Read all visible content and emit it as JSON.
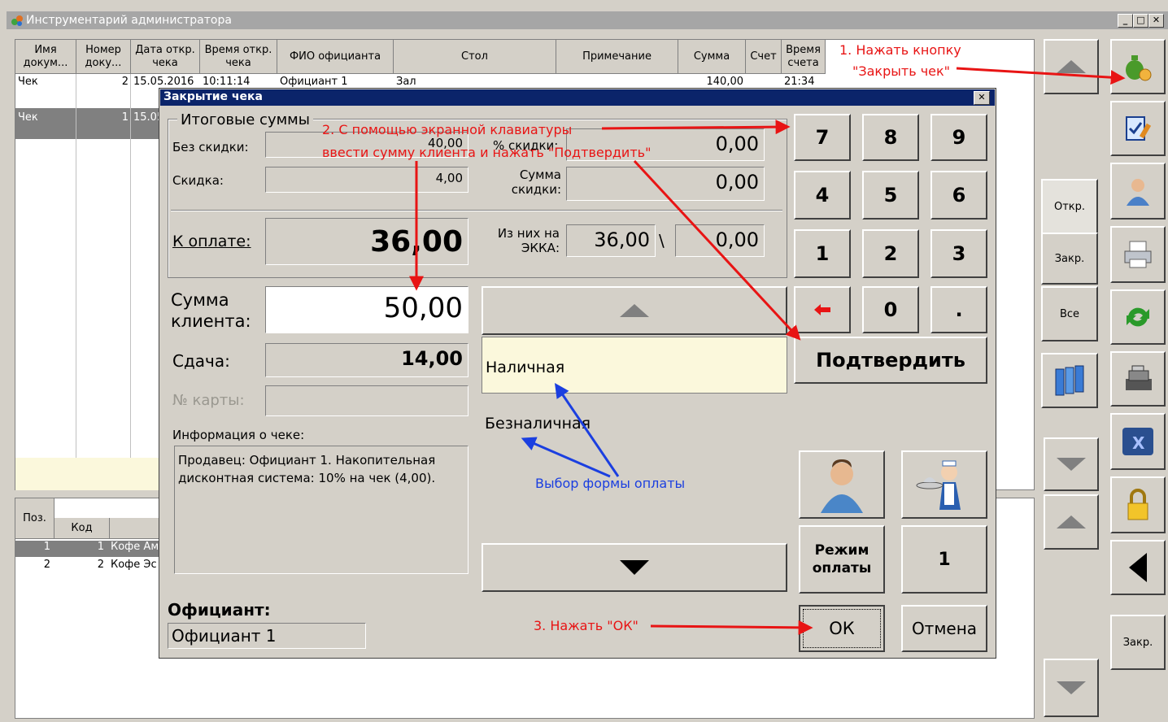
{
  "window": {
    "title": "Инструментарий администратора"
  },
  "table": {
    "headers": [
      "Имя докум...",
      "Номер доку...",
      "Дата откр. чека",
      "Время откр. чека",
      "ФИО официанта",
      "Стол",
      "Примечание",
      "Сумма",
      "Счет",
      "Время счета"
    ],
    "rows": [
      [
        "Чек",
        "2",
        "15.05.2016",
        "10:11:14",
        "Официант 1",
        "Зал",
        "",
        "140,00",
        "",
        "21:34"
      ],
      [
        "Чек",
        "1",
        "15.05",
        "",
        "",
        "",
        "",
        "",
        "",
        ""
      ]
    ]
  },
  "items_table": {
    "headers": [
      "Поз.",
      "Код"
    ],
    "rows": [
      [
        "1",
        "1",
        "Кофе Ам"
      ],
      [
        "2",
        "2",
        "Кофе Эс"
      ]
    ]
  },
  "right_panel": {
    "filter_open": "Откр.",
    "filter_closed": "Закр.",
    "filter_all": "Все",
    "close_label": "Закр."
  },
  "dialog": {
    "title": "Закрытие чека",
    "group_totals": "Итоговые суммы",
    "no_discount_label": "Без скидки:",
    "no_discount_value": "40,00",
    "discount_label": "Скидка:",
    "discount_value": "4,00",
    "discount_pct_label": "% скидки:",
    "discount_pct_value": "0,00",
    "discount_sum_label": "Сумма скидки:",
    "discount_sum_value": "0,00",
    "to_pay_label": "К оплате:",
    "to_pay_value": "36,00",
    "ekka_label": "Из них на ЭККА:",
    "ekka_value": "36,00",
    "ekka_slash": "\\",
    "ekka_value2": "0,00",
    "client_sum_label": "Сумма клиента:",
    "client_sum_value": "50,00",
    "change_label": "Сдача:",
    "change_value": "14,00",
    "card_label": "№ карты:",
    "info_label": "Информация о чеке:",
    "info_text": "Продавец: Официант 1. Накопительная дисконтная система: 10% на чек (4,00).",
    "waiter_label": "Официант:",
    "waiter_value": "Официант 1",
    "payment_options": [
      "Наличная",
      "Безналичная"
    ],
    "keys": [
      "7",
      "8",
      "9",
      "4",
      "5",
      "6",
      "1",
      "2",
      "3",
      "0",
      "."
    ],
    "confirm_label": "Подтвердить",
    "pay_mode_label": "Режим оплаты",
    "guest_count": "1",
    "ok_label": "ОК",
    "cancel_label": "Отмена"
  },
  "annotations": {
    "step1": "1. Нажать кнопку",
    "step1b": "\"Закрыть чек\"",
    "step2": "2. С помощью экранной клавиатуры",
    "step2b": "ввести сумму клиента и нажать \"Подтвердить\"",
    "step3": "3. Нажать \"ОК\"",
    "pay_choice": "Выбор формы оплаты"
  },
  "colors": {
    "selection": "#808080",
    "dialog_title": "#0b246a",
    "annot_red": "#e81414",
    "annot_blue": "#1b3fe0",
    "selected_payment": "#fbf8dc"
  }
}
